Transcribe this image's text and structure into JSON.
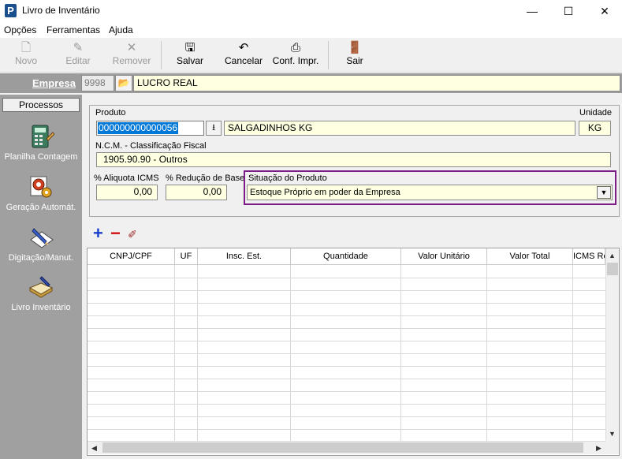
{
  "window": {
    "title": "Livro de Inventário",
    "app_icon": "P",
    "minimize": "—",
    "maximize": "☐",
    "close": "✕"
  },
  "menu": {
    "items": [
      "Opções",
      "Ferramentas",
      "Ajuda"
    ]
  },
  "toolbar": {
    "novo": "Novo",
    "editar": "Editar",
    "remover": "Remover",
    "salvar": "Salvar",
    "cancelar": "Cancelar",
    "conf_impr": "Conf. Impr.",
    "sair": "Sair"
  },
  "empresa": {
    "label": "Empresa",
    "code": "9998",
    "name": "LUCRO REAL"
  },
  "sidebar": {
    "header": "Processos",
    "items": [
      {
        "label": "Planilha Contagem",
        "icon": "calculator-icon"
      },
      {
        "label": "Geração Automát.",
        "icon": "gears-icon"
      },
      {
        "label": "Digitação/Manut.",
        "icon": "pencil-doc-icon"
      },
      {
        "label": "Livro Inventário",
        "icon": "book-pen-icon"
      }
    ]
  },
  "produto": {
    "label": "Produto",
    "code": "000000000000056",
    "description": "SALGADINHOS KG",
    "unidade_label": "Unidade",
    "unidade": "KG"
  },
  "ncm": {
    "label": "N.C.M. - Classificação Fiscal",
    "value": "1905.90.90 - Outros"
  },
  "aliquota": {
    "label": "% Aliquota ICMS",
    "value": "0,00"
  },
  "reducao": {
    "label": "% Redução de Base",
    "value": "0,00"
  },
  "situacao": {
    "label": "Situação do Produto",
    "selected": "Estoque Próprio em poder da Empresa",
    "highlight_color": "#7b1c88"
  },
  "grid": {
    "columns": [
      "CNPJ/CPF",
      "UF",
      "Insc. Est.",
      "Quantidade",
      "Valor Unitário",
      "Valor Total",
      "ICMS Re"
    ],
    "rows": []
  }
}
